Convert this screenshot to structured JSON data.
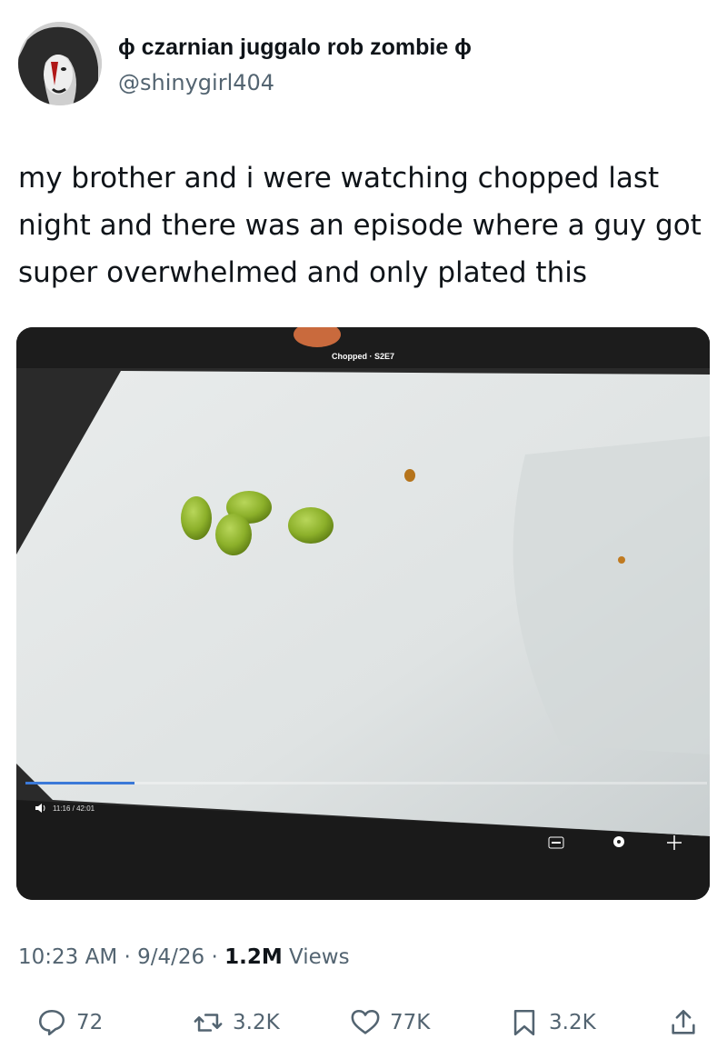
{
  "header": {
    "display_name": "ɸ czarnian juggalo rob zombie ɸ",
    "handle": "@shinygirl404"
  },
  "tweet": {
    "text_line1": "my brother and i were watching chopped last",
    "text_line2": "night and there was an episode where a guy got",
    "text_line3": "super overwhelmed and only plated this"
  },
  "media": {
    "video_title": "Chopped · S2E7",
    "time_code": "11:16 / 42:01",
    "progress": 0.16
  },
  "meta": {
    "time": "10:23 AM",
    "date": "9/4/26",
    "views_count": "1.2M",
    "views_label": "Views",
    "separator": "·"
  },
  "actions": {
    "replies": "72",
    "reposts": "3.2K",
    "likes": "77K",
    "bookmarks": "3.2K"
  },
  "icons": [
    "avatar-image",
    "reply-icon",
    "repost-icon",
    "like-icon",
    "bookmark-icon",
    "share-icon",
    "volume-icon",
    "captions-icon",
    "settings-icon",
    "fullscreen-icon"
  ]
}
